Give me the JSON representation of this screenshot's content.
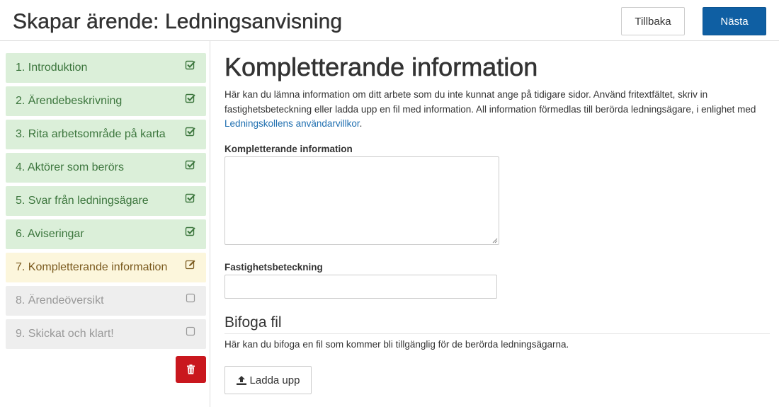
{
  "header": {
    "title": "Skapar ärende: Ledningsanvisning",
    "back_label": "Tillbaka",
    "next_label": "Nästa"
  },
  "sidebar": {
    "steps": [
      {
        "label": "1. Introduktion",
        "status": "done",
        "icon": "check-square-icon"
      },
      {
        "label": "2. Ärendebeskrivning",
        "status": "done",
        "icon": "check-square-icon"
      },
      {
        "label": "3. Rita arbetsområde på karta",
        "status": "done",
        "icon": "check-square-icon"
      },
      {
        "label": "4. Aktörer som berörs",
        "status": "done",
        "icon": "check-square-icon"
      },
      {
        "label": "5. Svar från ledningsägare",
        "status": "done",
        "icon": "check-square-icon"
      },
      {
        "label": "6. Aviseringar",
        "status": "done",
        "icon": "check-square-icon"
      },
      {
        "label": "7. Kompletterande information",
        "status": "current",
        "icon": "edit-icon"
      },
      {
        "label": "8. Ärendeöversikt",
        "status": "todo",
        "icon": "empty-square-icon"
      },
      {
        "label": "9. Skickat och klart!",
        "status": "todo",
        "icon": "empty-square-icon"
      }
    ],
    "delete_icon": "trash-icon"
  },
  "main": {
    "heading": "Kompletterande information",
    "intro_text": "Här kan du lämna information om ditt arbete som du inte kunnat ange på tidigare sidor. Använd fritextfältet, skriv in fastighetsbeteckning eller ladda upp en fil med information. All information förmedlas till berörda ledningsägare, i enlighet med ",
    "intro_link": "Ledningskollens användarvillkor",
    "intro_end": ".",
    "textarea_label": "Kompletterande information",
    "textarea_value": "",
    "property_label": "Fastighetsbeteckning",
    "property_value": "",
    "attach_heading": "Bifoga fil",
    "attach_text": "Här kan du bifoga en fil som kommer bli tillgänglig för de berörda ledningsägarna.",
    "upload_label": "Ladda upp",
    "upload_icon": "upload-icon"
  },
  "colors": {
    "primary": "#0f5fa3",
    "done_bg": "#dbefd9",
    "done_text": "#3c763d",
    "current_bg": "#fcf6dc",
    "todo_bg": "#eeeeee",
    "danger": "#c9171e",
    "link": "#1f6fb0"
  }
}
